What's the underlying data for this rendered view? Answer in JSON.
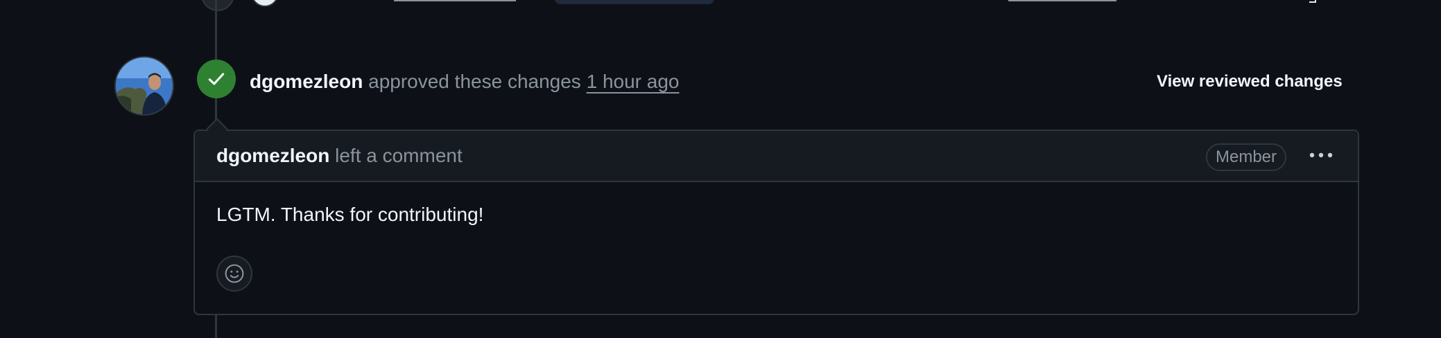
{
  "review": {
    "author": "dgomezleon",
    "action": "approved these changes",
    "time": "1 hour ago",
    "view_changes_label": "View reviewed changes"
  },
  "comment": {
    "author": "dgomezleon",
    "action": "left a comment",
    "role_badge": "Member",
    "body": "LGTM. Thanks for contributing!"
  },
  "icons": {
    "approved": "check-icon",
    "more": "kebab-horizontal-icon",
    "reaction": "smiley-icon"
  },
  "colors": {
    "background": "#0d1117",
    "approved_green": "#2f8132",
    "muted_text": "#8b949e",
    "border": "#30363d"
  }
}
